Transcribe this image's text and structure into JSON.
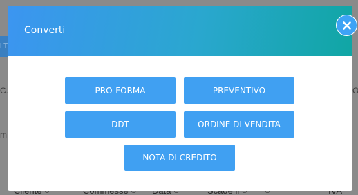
{
  "modal": {
    "title": "Converti",
    "buttons": [
      "PRO-FORMA",
      "PREVENTIVO",
      "DDT",
      "ORDINE DI VENDITA",
      "NOTA DI CREDITO"
    ]
  },
  "background": {
    "tab_fragment": "i T",
    "left_fragments": [
      "C.",
      "m"
    ],
    "right_fragment": "O",
    "columns": [
      "Cliente",
      "Commesse",
      "Data",
      "Scade il",
      "IVA"
    ]
  },
  "icons": {
    "close": "close-icon",
    "column_search": "search-icon"
  },
  "colors": {
    "button": "#40a0f2",
    "header_start": "#3c95f1",
    "header_end": "#10a6a4"
  }
}
